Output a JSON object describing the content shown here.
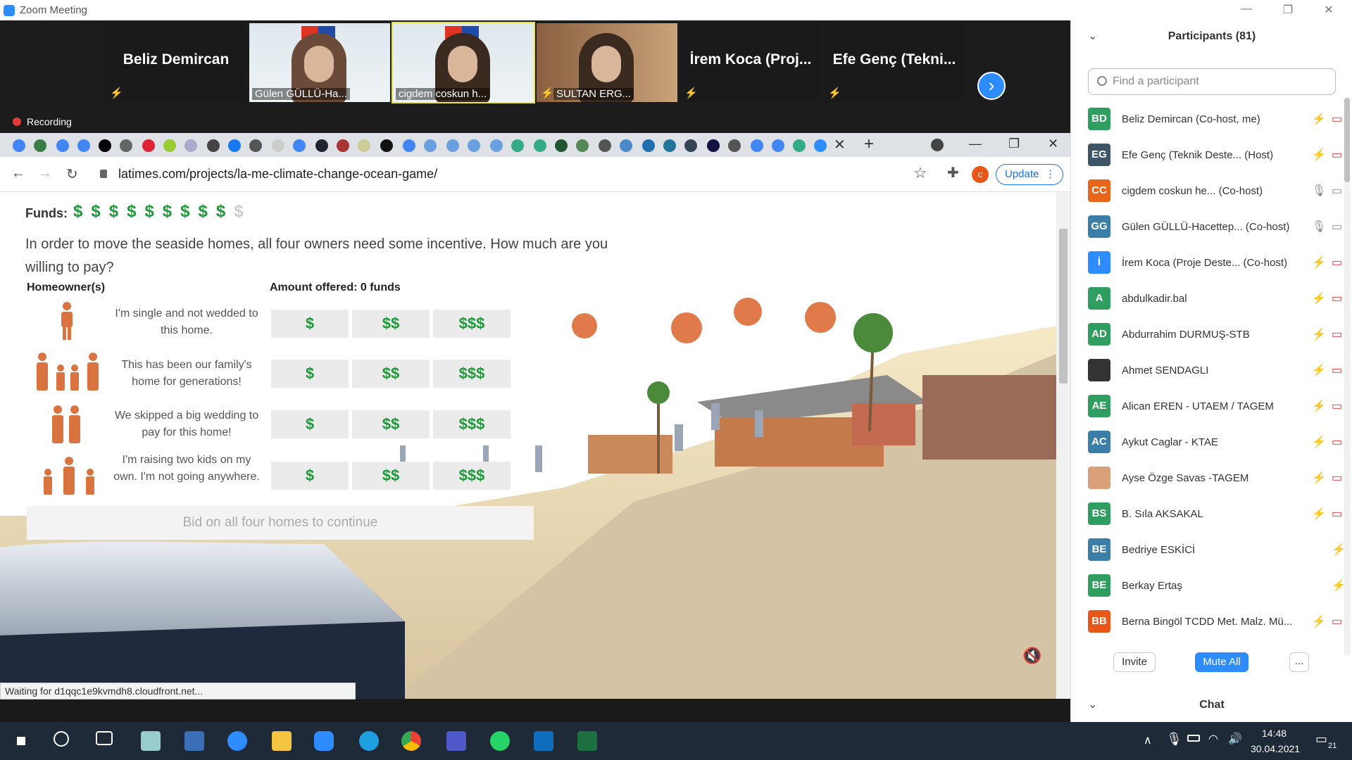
{
  "zoom": {
    "title": "Zoom Meeting",
    "recording_label": "Recording",
    "tiles": [
      {
        "name": "Beliz Demircan",
        "type": "name"
      },
      {
        "name": "Gülen GÜLLÜ-Ha...",
        "type": "video"
      },
      {
        "name": "cigdem coskun h...",
        "type": "video"
      },
      {
        "name": "SULTAN ERG...",
        "type": "video"
      },
      {
        "name": "İrem Koca (Proj...",
        "type": "name"
      },
      {
        "name": "Efe Genç (Tekni...",
        "type": "name"
      }
    ]
  },
  "browser": {
    "url": "latimes.com/projects/la-me-climate-change-ocean-game/",
    "update_label": "Update",
    "profile_initial": "c",
    "status_text": "Waiting for d1qqc1e9kvmdh8.cloudfront.net..."
  },
  "game": {
    "funds_label": "Funds:",
    "funds_total": 10,
    "funds_available": 9,
    "question": "In order to move the seaside homes, all four owners need some incentive. How much are you willing to pay?",
    "col_owner": "Homeowner(s)",
    "col_amount": "Amount offered: 0 funds",
    "bid_options": [
      "$",
      "$$",
      "$$$"
    ],
    "rows": [
      {
        "text": "I'm single and not wedded to this home."
      },
      {
        "text": "This has been our family's home for generations!"
      },
      {
        "text": "We skipped a big wedding to pay for this home!"
      },
      {
        "text": "I'm raising two kids on my own. I'm not going anywhere."
      }
    ],
    "continue_label": "Bid on all four homes to continue"
  },
  "participants": {
    "title": "Participants (81)",
    "search_placeholder": "Find a participant",
    "list": [
      {
        "initials": "BD",
        "name": "Beliz Demircan (Co-host, me)",
        "color": "#2f9e60",
        "mic": "off",
        "cam": "off"
      },
      {
        "initials": "EG",
        "name": "Efe Genç (Teknik Deste... (Host)",
        "color": "#3d5566",
        "mic": "off",
        "cam": "off"
      },
      {
        "initials": "CC",
        "name": "cigdem coskun he...   (Co-host)",
        "color": "#e8661a",
        "mic": "on",
        "cam": "on"
      },
      {
        "initials": "GG",
        "name": "Gülen GÜLLÜ-Hacettep...  (Co-host)",
        "color": "#3b7ea8",
        "mic": "on",
        "cam": "on"
      },
      {
        "initials": "İ",
        "name": "İrem Koca (Proje Deste...  (Co-host)",
        "color": "#2d8cff",
        "mic": "off",
        "cam": "off"
      },
      {
        "initials": "A",
        "name": "abdulkadir.bal",
        "color": "#2f9e60",
        "mic": "off",
        "cam": "off"
      },
      {
        "initials": "AD",
        "name": "Abdurrahim DURMUŞ-STB",
        "color": "#2f9e60",
        "mic": "off",
        "cam": "off"
      },
      {
        "initials": "",
        "name": "Ahmet SENDAGLI",
        "color": "#333333",
        "mic": "off",
        "cam": "off"
      },
      {
        "initials": "AE",
        "name": "Alican EREN - UTAEM / TAGEM",
        "color": "#2f9e60",
        "mic": "off",
        "cam": "off"
      },
      {
        "initials": "AC",
        "name": "Aykut Caglar - KTAE",
        "color": "#3b7ea8",
        "mic": "off",
        "cam": "off"
      },
      {
        "initials": "",
        "name": "Ayse Özge Savas -TAGEM",
        "color": "#d9a07a",
        "mic": "off",
        "cam": "off"
      },
      {
        "initials": "BS",
        "name": "B. Sıla AKSAKAL",
        "color": "#2f9e60",
        "mic": "off",
        "cam": "off"
      },
      {
        "initials": "BE",
        "name": "Bedriye ESKİCİ",
        "color": "#3b7ea8",
        "mic": "off",
        "cam": "none"
      },
      {
        "initials": "BE",
        "name": "Berkay Ertaş",
        "color": "#2f9e60",
        "mic": "off",
        "cam": "none"
      },
      {
        "initials": "BB",
        "name": "Berna Bingöl TCDD Met. Malz. Mü...",
        "color": "#e8561a",
        "mic": "off",
        "cam": "off"
      }
    ],
    "invite_label": "Invite",
    "mute_all_label": "Mute All",
    "more_label": "...",
    "chat_label": "Chat"
  },
  "taskbar": {
    "time": "14:48",
    "date": "30.04.2021",
    "notification_count": "21"
  }
}
